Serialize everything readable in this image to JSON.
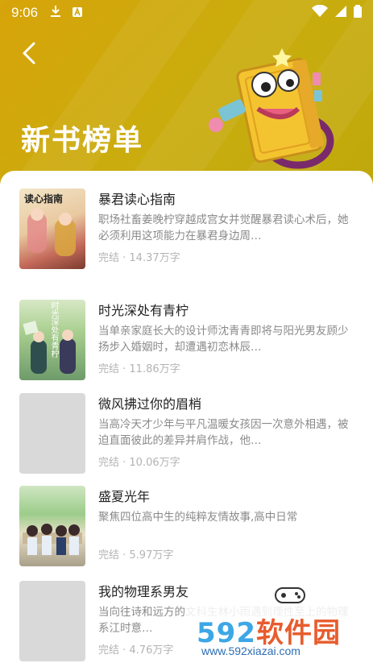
{
  "status_bar": {
    "time": "9:06"
  },
  "header": {
    "title": "新书榜单"
  },
  "books": [
    {
      "title": "暴君读心指南",
      "desc": "职场社畜姜晚柠穿越成宫女并觉醒暴君读心术后，她必须利用这项能力在暴君身边周…",
      "meta": "完结 · 14.37万字",
      "cover_text": "读心指南"
    },
    {
      "title": "时光深处有青柠",
      "desc": "当单亲家庭长大的设计师沈青青即将与阳光男友顾少扬步入婚姻时，却遭遇初恋林辰…",
      "meta": "完结 · 11.86万字",
      "cover_text": "时光深处有青柠"
    },
    {
      "title": "微风拂过你的眉梢",
      "desc": "当高冷天才少年与平凡温暖女孩因一次意外相遇，被迫直面彼此的差异并肩作战，他…",
      "meta": "完结 · 10.06万字",
      "cover_text": ""
    },
    {
      "title": "盛夏光年",
      "desc": "聚焦四位高中生的纯粹友情故事,高中日常",
      "meta": "完结 · 5.97万字",
      "cover_text": ""
    },
    {
      "title": "我的物理系男友",
      "desc": "当向往诗和远方的文科生林小雨遇到理性至上的物理系江时意…",
      "meta": "完结 · 4.76万字",
      "cover_text": ""
    }
  ],
  "watermark": {
    "brand_num": "592",
    "brand_cn": "软件园",
    "url": "www.592xiazai.com"
  },
  "colors": {
    "header_bg": "#d4a90b",
    "title_text": "#222222",
    "desc_text": "#8a8a8a",
    "meta_text": "#b3b3b3"
  }
}
